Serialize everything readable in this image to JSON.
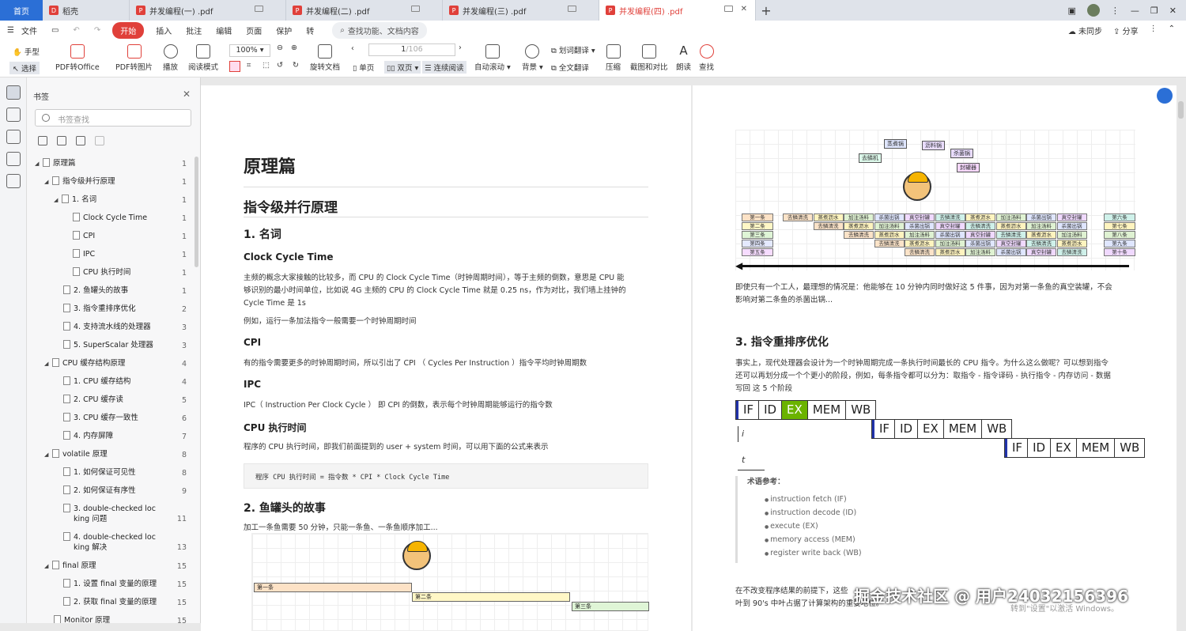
{
  "tabs": {
    "home": "首页",
    "daoke": "稻壳",
    "pdf": [
      "并发编程(一) .pdf",
      "并发编程(二) .pdf",
      "并发编程(三) .pdf",
      "并发编程(四) .pdf"
    ],
    "plus": "+"
  },
  "menu": {
    "file": "文件",
    "start": "开始",
    "items": [
      "插入",
      "批注",
      "编辑",
      "页面",
      "保护",
      "转"
    ],
    "search": "查找功能、文档内容",
    "unsync": "未同步",
    "share": "分享"
  },
  "toolbar": {
    "hand": "手型",
    "select": "选择",
    "pdf_office": "PDF转Office",
    "pdf_img": "PDF转图片",
    "play": "播放",
    "read": "阅读模式",
    "zoom": "100%",
    "rotate": "旋转文档",
    "page": "1",
    "page_total": "/106",
    "single": "单页",
    "double": "双页",
    "continuous": "连续阅读",
    "auto_scroll": "自动滚动",
    "bg": "背景",
    "translate": "划词翻译",
    "full_translate": "全文翻译",
    "compress": "压缩",
    "screenshot": "截图和对比",
    "read_aloud": "朗读",
    "find": "查找"
  },
  "bookmarks": {
    "title": "书签",
    "search_placeholder": "书签查找",
    "items": [
      {
        "label": "原理篇",
        "page": "1"
      },
      {
        "label": "指令级并行原理",
        "page": "1"
      },
      {
        "label": "1. 名词",
        "page": "1"
      },
      {
        "label": "Clock Cycle Time",
        "page": "1"
      },
      {
        "label": "CPI",
        "page": "1"
      },
      {
        "label": "IPC",
        "page": "1"
      },
      {
        "label": "CPU 执行时间",
        "page": "1"
      },
      {
        "label": "2. 鱼罐头的故事",
        "page": "1"
      },
      {
        "label": "3. 指令重排序优化",
        "page": "2"
      },
      {
        "label": "4. 支持流水线的处理器",
        "page": "3"
      },
      {
        "label": "5. SuperScalar 处理器",
        "page": "3"
      },
      {
        "label": "CPU 缓存结构原理",
        "page": "4"
      },
      {
        "label": "1. CPU 缓存结构",
        "page": "4"
      },
      {
        "label": "2. CPU 缓存读",
        "page": "5"
      },
      {
        "label": "3. CPU 缓存一致性",
        "page": "6"
      },
      {
        "label": "4. 内存屏障",
        "page": "7"
      },
      {
        "label": "volatile 原理",
        "page": "8"
      },
      {
        "label": "1. 如何保证可见性",
        "page": "8"
      },
      {
        "label": "2. 如何保证有序性",
        "page": "9"
      },
      {
        "label": "3. double-checked loc",
        "label2": "king 问题",
        "page": "11"
      },
      {
        "label": "4. double-checked loc",
        "label2": "king 解决",
        "page": "13"
      },
      {
        "label": "final 原理",
        "page": "15"
      },
      {
        "label": "1. 设置 final 变量的原理",
        "page": "15"
      },
      {
        "label": "2. 获取 final 变量的原理",
        "page": "15"
      },
      {
        "label": "Monitor 原理",
        "page": "15"
      }
    ]
  },
  "left_page": {
    "h1": "原理篇",
    "h2": "指令级并行原理",
    "s1": "1. 名词",
    "cct": "Clock Cycle Time",
    "cct_p": [
      "主频的概念大家接触的比较多，而 CPU 的 Clock Cycle Time（时钟周期时间），等于主频的倒数，意思是 CPU 能",
      "够识别的最小时间单位，比如说 4G 主频的 CPU 的 Clock Cycle Time 就是 0.25 ns，作为对比，我们墙上挂钟的",
      "Cycle Time 是 1s"
    ],
    "example": "例如，运行一条加法指令一般需要一个时钟周期时间",
    "cpi": "CPI",
    "cpi_p": "有的指令需要更多的时钟周期时间，所以引出了 CPI （ Cycles Per Instruction ）指令平均时钟周期数",
    "ipc": "IPC",
    "ipc_p": "IPC（ Instruction Per Clock Cycle ） 即 CPI 的倒数，表示每个时钟周期能够运行的指令数",
    "cput": "CPU 执行时间",
    "cput_p": "程序的 CPU 执行时间，即我们前面提到的 user + system 时间，可以用下面的公式来表示",
    "code": "程序 CPU 执行时间 = 指令数 * CPI * Clock Cycle Time",
    "s2": "2. 鱼罐头的故事",
    "s2_p": "加工一条鱼需要 50 分钟，只能一条鱼、一条鱼顺序加工...",
    "fig": [
      "第一条",
      "第二条",
      "第三条"
    ]
  },
  "right_page": {
    "nodes": [
      "去鳞机",
      "蒸煮锅",
      "沥料锅",
      "杀菌锅",
      "封罐器"
    ],
    "left_labels": [
      "第一条",
      "第二条",
      "第三条",
      "第四条",
      "第五条"
    ],
    "right_labels": [
      "第六条",
      "第七条",
      "第八条",
      "第九条",
      "第十条"
    ],
    "grid": [
      [
        "去鳞清洗",
        "蒸煮沥水",
        "加注汤料",
        "杀菌出锅",
        "真空封罐",
        "去鳞清洗",
        "蒸煮沥水",
        "加注汤料",
        "杀菌出锅",
        "真空封罐"
      ],
      [
        "去鳞清洗",
        "蒸煮沥水",
        "加注汤料",
        "杀菌出锅",
        "真空封罐",
        "去鳞清洗",
        "蒸煮沥水",
        "加注汤料",
        "杀菌出锅"
      ],
      [
        "去鳞清洗",
        "蒸煮沥水",
        "加注汤料",
        "杀菌出锅",
        "真空封罐",
        "去鳞清洗",
        "蒸煮沥水",
        "加注汤料"
      ],
      [
        "去鳞清洗",
        "蒸煮沥水",
        "加注汤料",
        "杀菌出锅",
        "真空封罐",
        "去鳞清洗",
        "蒸煮沥水"
      ],
      [
        "去鳞清洗",
        "蒸煮沥水",
        "加注汤料",
        "杀菌出锅",
        "真空封罐",
        "去鳞清洗"
      ]
    ],
    "p1": [
      "即使只有一个工人，最理想的情况是：他能够在 10 分钟内同时做好这 5 件事，因为对第一条鱼的真空装罐，不会",
      "影响对第二条鱼的杀菌出锅..."
    ],
    "s3": "3. 指令重排序优化",
    "p2": [
      "事实上，现代处理器会设计为一个时钟周期完成一条执行时间最长的 CPU 指令。为什么这么做呢？可以想到指令",
      "还可以再划分成一个个更小的阶段，例如，每条指令都可以分为：取指令 - 指令译码 - 执行指令 - 内存访问 - 数据",
      "写回  这 5 个阶段"
    ],
    "pipe": [
      "IF",
      "ID",
      "EX",
      "MEM",
      "WB"
    ],
    "i_label": "i",
    "t_label": "t",
    "term_title": "术语参考：",
    "terms": [
      "instruction fetch (IF)",
      "instruction decode (ID)",
      "execute (EX)",
      "memory access (MEM)",
      "register write back (WB)"
    ],
    "p3": [
      "在不改变程序结果的前提下，这些",
      "叶到 90's 中叶占据了计算架构的重要地位。"
    ]
  },
  "watermark": "掘金技术社区 @ 用户24032156396",
  "activate": "转到\"设置\"以激活 Windows。"
}
